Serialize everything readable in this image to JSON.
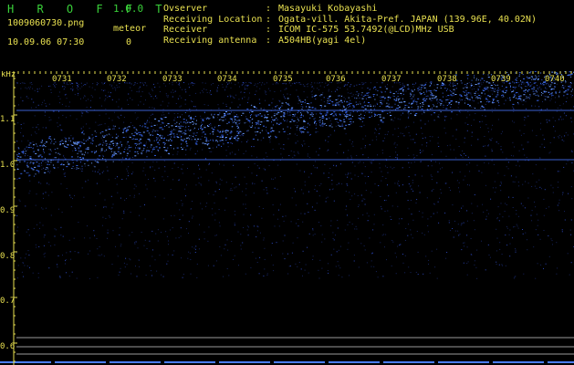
{
  "header": {
    "app_title": "H R O F F T",
    "app_version": "1.0.0",
    "file_name": "1009060730.png",
    "meteor_label": "meteor",
    "datetime": "10.09.06 07:30",
    "meteor_count": "0",
    "info": [
      {
        "label": "Ovserver",
        "sep": ":",
        "value": "Masayuki Kobayashi"
      },
      {
        "label": "Receiving Location",
        "sep": ":",
        "value": "Ogata-vill. Akita-Pref. JAPAN (139.96E, 40.02N)"
      },
      {
        "label": "Receiver",
        "sep": ":",
        "value": "ICOM IC-575 53.7492(@LCD)MHz USB"
      },
      {
        "label": "Receiving antenna",
        "sep": ":",
        "value": "A504HB(yagi 4el)"
      }
    ]
  },
  "spectrogram": {
    "unit_label": "kHz",
    "time_labels": [
      "0731",
      "0732",
      "0733",
      "0734",
      "0735",
      "0736",
      "0737",
      "0738",
      "0739",
      "0740"
    ],
    "freq_labels": [
      "1.1",
      "1.0",
      "0.9",
      "0.8",
      "0.7",
      "0.6"
    ],
    "colors": {
      "text": "#e8e050",
      "signal": "#4a7dff",
      "background": "#000000",
      "title": "#3ad13a"
    }
  }
}
